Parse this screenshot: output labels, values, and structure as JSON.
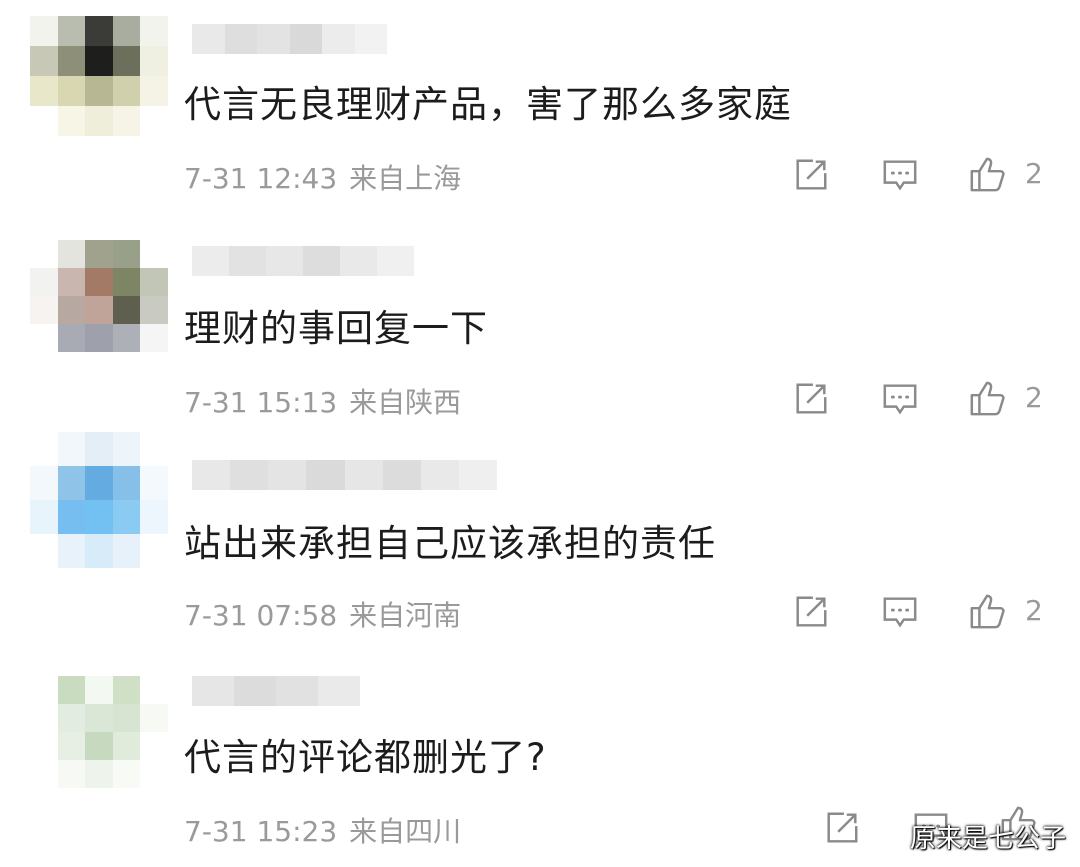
{
  "comments": [
    {
      "text": "代言无良理财产品，害了那么多家庭",
      "date": "7-31 12:43",
      "location": "来自上海",
      "likes": "2"
    },
    {
      "text": "理财的事回复一下",
      "date": "7-31 15:13",
      "location": "来自陕西",
      "likes": "2"
    },
    {
      "text": "站出来承担自己应该承担的责任",
      "date": "7-31 07:58",
      "location": "来自河南",
      "likes": "2"
    },
    {
      "text": "代言的评论都删光了?",
      "date": "7-31 15:23",
      "location": "来自四川",
      "likes": ""
    }
  ],
  "watermark": "原来是七公子",
  "icons": [
    "repost-icon",
    "comment-icon",
    "thumbs-up-icon"
  ],
  "colors": {
    "text": "#1c1c1c",
    "meta": "#9a9a9a",
    "icon": "#8a8a8a"
  }
}
